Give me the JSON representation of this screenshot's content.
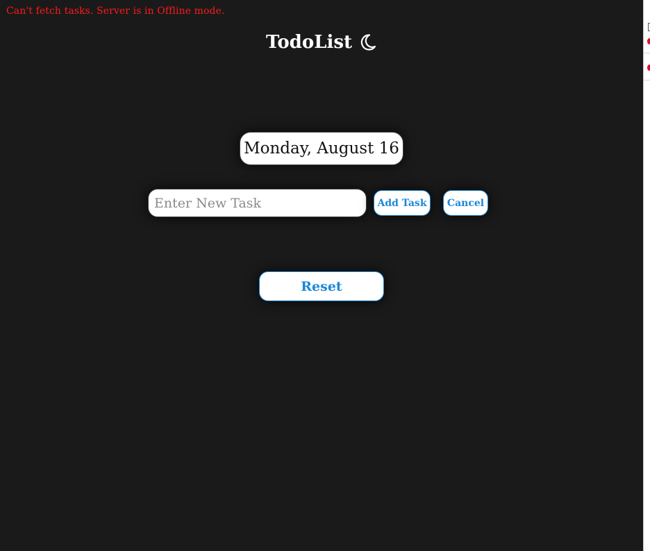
{
  "error": {
    "message": "Can't fetch tasks. Server is in Offline mode."
  },
  "header": {
    "title": "TodoList",
    "theme_toggle_icon": "moon-icon"
  },
  "date": {
    "label": "Monday, August 16"
  },
  "task_form": {
    "input_placeholder": "Enter New Task",
    "input_value": "",
    "add_label": "Add Task",
    "cancel_label": "Cancel"
  },
  "reset": {
    "label": "Reset"
  },
  "colors": {
    "background": "#1a1a1a",
    "error": "#ff1a1a",
    "accent": "#1b87d8",
    "surface": "#ffffff"
  }
}
